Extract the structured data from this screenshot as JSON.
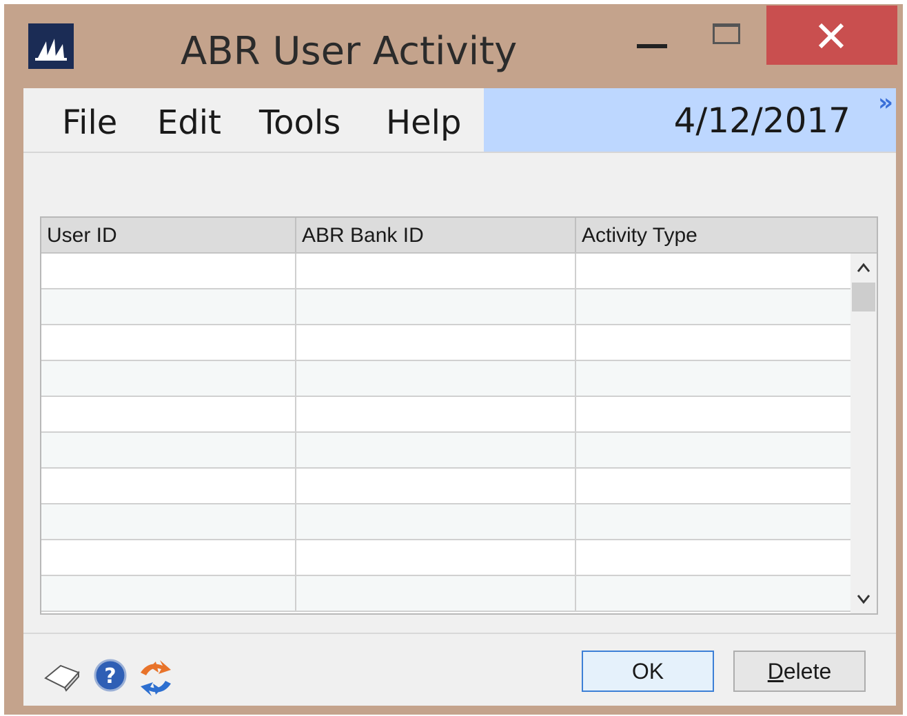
{
  "window": {
    "title": "ABR User Activity"
  },
  "menu": {
    "items": [
      "File",
      "Edit",
      "Tools",
      "Help"
    ],
    "date": "4/12/2017",
    "expand_glyph": "»"
  },
  "grid": {
    "columns": [
      "User ID",
      "ABR Bank ID",
      "Activity Type"
    ],
    "rows": [
      [
        "",
        "",
        ""
      ],
      [
        "",
        "",
        ""
      ],
      [
        "",
        "",
        ""
      ],
      [
        "",
        "",
        ""
      ],
      [
        "",
        "",
        ""
      ],
      [
        "",
        "",
        ""
      ],
      [
        "",
        "",
        ""
      ],
      [
        "",
        "",
        ""
      ],
      [
        "",
        "",
        ""
      ],
      [
        "",
        "",
        ""
      ]
    ]
  },
  "footer": {
    "icons": [
      "note-icon",
      "help-icon",
      "refresh-icon"
    ],
    "ok_label": "OK",
    "delete_first": "D",
    "delete_rest": "elete"
  },
  "colors": {
    "frame": "#c4a38c",
    "close": "#c94f4f",
    "menu_highlight": "#bdd7ff",
    "logo": "#1b2c55"
  }
}
